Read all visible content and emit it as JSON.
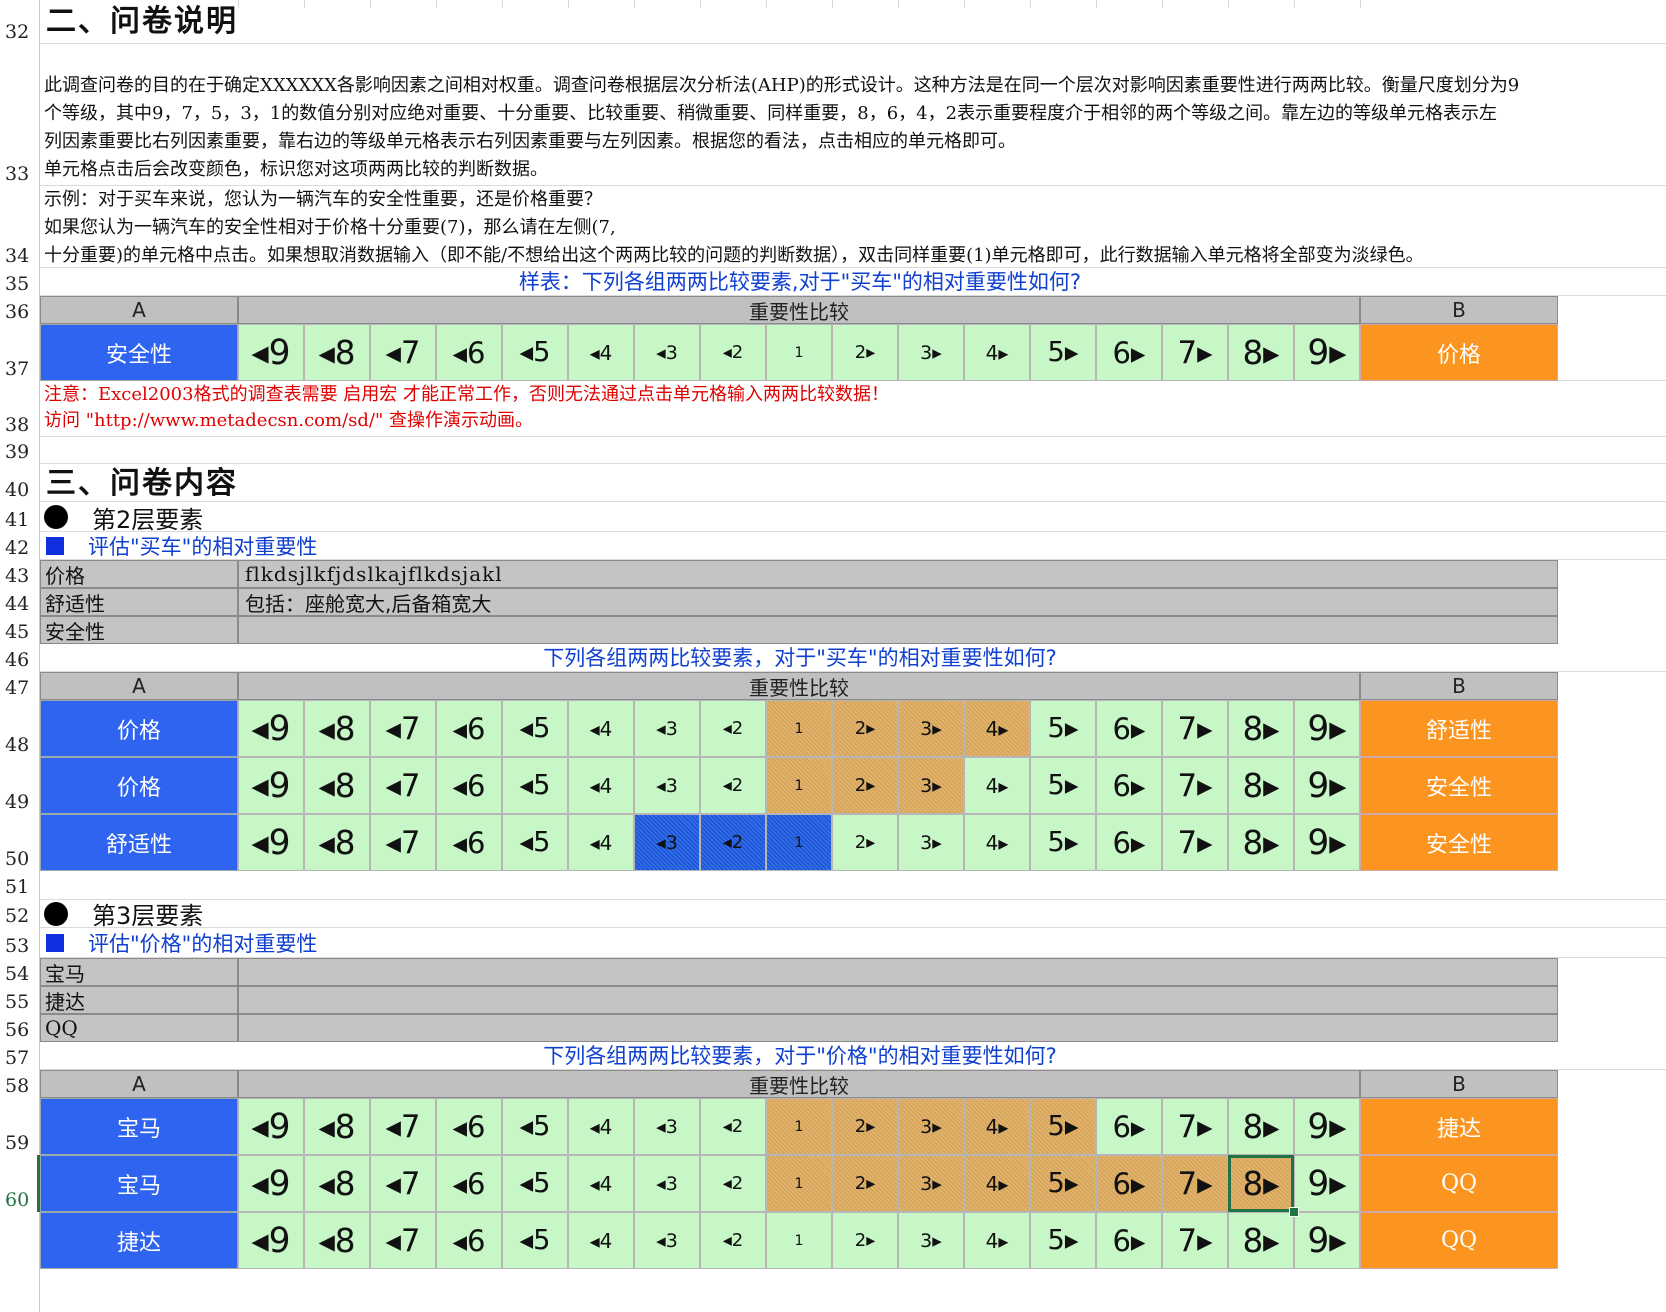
{
  "section2": {
    "title": "二、问卷说明",
    "para1_line1": "此调查问卷的目的在于确定XXXXXX各影响因素之间相对权重。调查问卷根据层次分析法(AHP)的形式设计。这种方法是在同一个层次对影响因素重要性进行两两比较。衡量尺度划分为9",
    "para1_line2": "个等级，其中9，7，5，3，1的数值分别对应绝对重要、十分重要、比较重要、稍微重要、同样重要，8，6，4，2表示重要程度介于相邻的两个等级之间。靠左边的等级单元格表示左",
    "para1_line3": "列因素重要比右列因素重要，靠右边的等级单元格表示右列因素重要与左列因素。根据您的看法，点击相应的单元格即可。",
    "para1_line4": "单元格点击后会改变颜色，标识您对这项两两比较的判断数据。",
    "para2_line1": "示例：对于买车来说，您认为一辆汽车的安全性重要，还是价格重要？",
    "para2_line2": "如果您认为一辆汽车的安全性相对于价格十分重要(7)，那么请在左侧(7,",
    "para2_line3": "十分重要)的单元格中点击。如果想取消数据输入（即不能/不想给出这个两两比较的问题的判断数据），双击同样重要(1)单元格即可，此行数据输入单元格将全部变为淡绿色。",
    "sample_title": "样表：下列各组两两比较要素,对于\"买车\"的相对重要性如何?",
    "note1": "注意：Excel2003格式的调查表需要 启用宏 才能正常工作，否则无法通过点击单元格输入两两比较数据！",
    "note2": "访问 \"http://www.metadecsn.com/sd/\" 查操作演示动画。"
  },
  "headers": {
    "a": "A",
    "mid": "重要性比较",
    "b": "B"
  },
  "scale_labels": [
    "◂9",
    "◂8",
    "◂7",
    "◂6",
    "◂5",
    "◂4",
    "◂3",
    "◂2",
    "1",
    "2▸",
    "3▸",
    "4▸",
    "5▸",
    "6▸",
    "7▸",
    "8▸",
    "9▸"
  ],
  "sample_row": {
    "a": "安全性",
    "b": "价格"
  },
  "section3": {
    "title": "三、问卷内容",
    "level2": "第2层要素",
    "level2_eval": "评估\"买车\"的相对重要性",
    "level2_items": [
      {
        "name": "价格",
        "desc": "flkdsjlkfjdslkajflkdsjakl"
      },
      {
        "name": "舒适性",
        "desc": "包括：座舱宽大,后备箱宽大"
      },
      {
        "name": "安全性",
        "desc": ""
      }
    ],
    "level2_question": "下列各组两两比较要素，对于\"买车\"的相对重要性如何?",
    "level2_pairs": [
      {
        "a": "价格",
        "b": "舒适性"
      },
      {
        "a": "价格",
        "b": "安全性"
      },
      {
        "a": "舒适性",
        "b": "安全性"
      }
    ],
    "level3": "第3层要素",
    "level3_eval": "评估\"价格\"的相对重要性",
    "level3_items": [
      {
        "name": "宝马",
        "desc": ""
      },
      {
        "name": "捷达",
        "desc": ""
      },
      {
        "name": "QQ",
        "desc": ""
      }
    ],
    "level3_question": "下列各组两两比较要素，对于\"价格\"的相对重要性如何?",
    "level3_pairs": [
      {
        "a": "宝马",
        "b": "捷达"
      },
      {
        "a": "宝马",
        "b": "QQ"
      },
      {
        "a": "捷达",
        "b": "QQ"
      }
    ]
  },
  "row_numbers": [
    "32",
    "33",
    "34",
    "35",
    "36",
    "37",
    "38",
    "39",
    "40",
    "41",
    "42",
    "43",
    "44",
    "45",
    "46",
    "47",
    "48",
    "49",
    "50",
    "51",
    "52",
    "53",
    "54",
    "55",
    "56",
    "57",
    "58",
    "59",
    "60"
  ]
}
